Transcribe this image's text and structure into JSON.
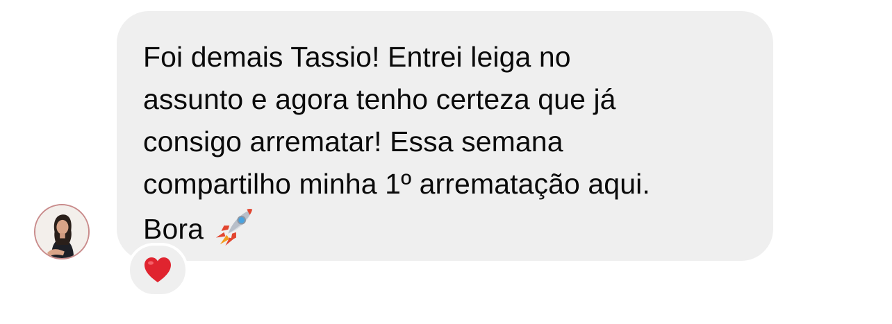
{
  "message": {
    "lines": [
      "Foi demais Tassio! Entrei leiga no",
      "assunto e agora tenho certeza que já",
      "consigo arrematar! Essa semana",
      "compartilho minha 1º arrematação aqui.",
      "Bora"
    ],
    "trailing_emoji": "rocket-icon",
    "bubble_color": "#efefef",
    "text_color": "#0a0a0a"
  },
  "sender": {
    "avatar": "avatar",
    "avatar_ring_color": "#c98b8b"
  },
  "reaction": {
    "emoji": "heart-icon",
    "color": "#e0242f"
  }
}
